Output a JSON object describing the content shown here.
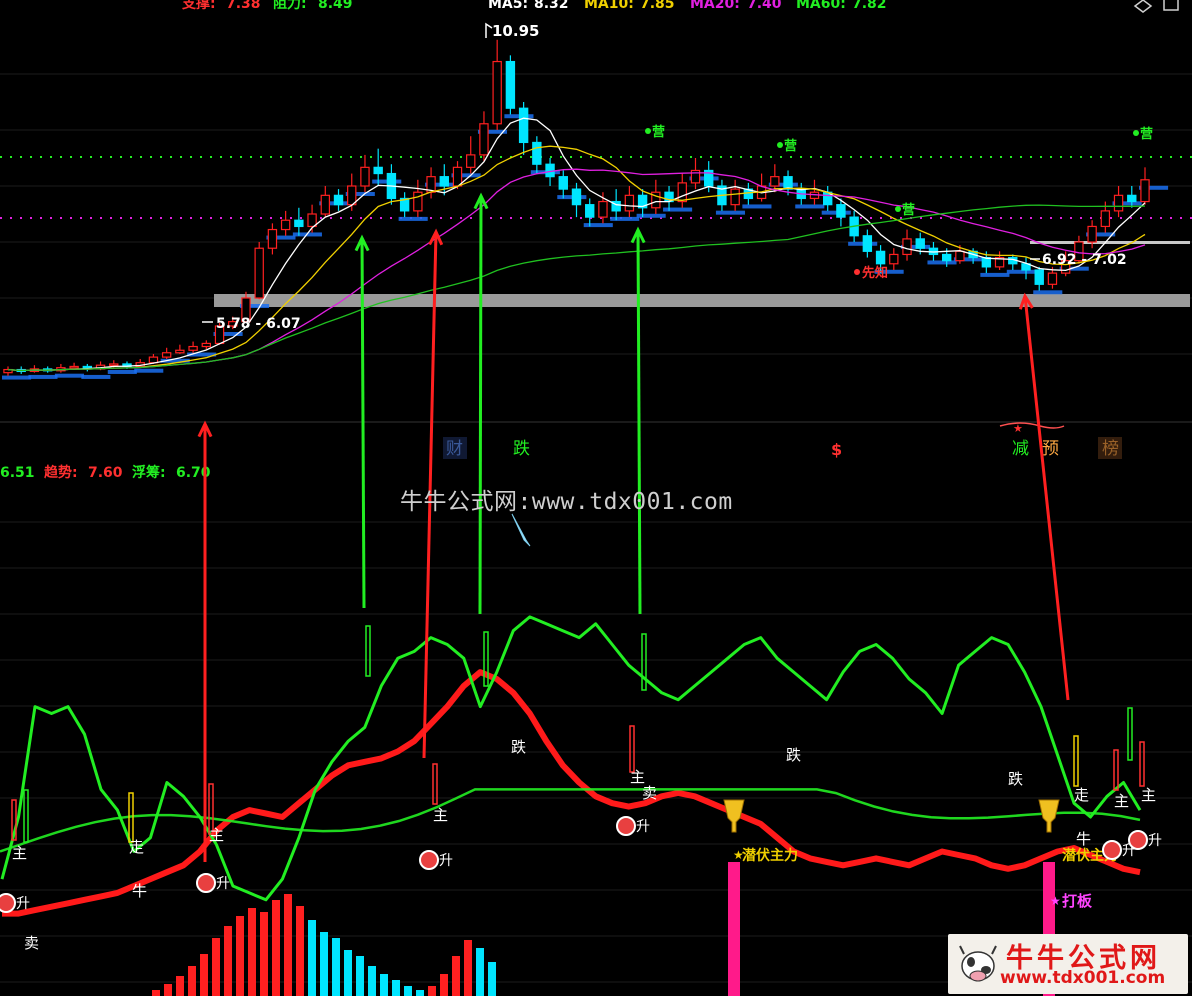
{
  "header": {
    "support_label": "支撑:",
    "support_value": "7.38",
    "resist_label": "阻力:",
    "resist_value": "8.49",
    "ma5_label": "MA5:",
    "ma5_value": "8.32",
    "ma10_label": "MA10:",
    "ma10_value": "7.85",
    "ma20_label": "MA20:",
    "ma20_value": "7.40",
    "ma60_label": "MA60:",
    "ma60_value": "7.82"
  },
  "indicator_header": {
    "first_value": "6.51",
    "trend_label": "趋势:",
    "trend_value": "7.60",
    "float_label": "浮筹:",
    "float_value": "6.70"
  },
  "price_labels": {
    "high": "10.95",
    "low_range": "5.78 - 6.07",
    "right_range": "6.92 - 7.02"
  },
  "event_labels": [
    {
      "text": "财",
      "color": "#6aa0ff"
    },
    {
      "text": "跌",
      "color": "#22ee22"
    },
    {
      "text": "$",
      "color": "#ff3030"
    },
    {
      "text": "减",
      "color": "#22ee22"
    },
    {
      "text": "预",
      "color": "#ffaa44"
    },
    {
      "text": "榜",
      "color": "#ffaa44"
    }
  ],
  "chart_markers": {
    "ying": "营",
    "zhu": "主",
    "zou": "走",
    "niu": "牛",
    "sheng": "升",
    "mai_sell": "卖",
    "die": "跌",
    "xian_zhi": "先知",
    "qian_fu": "潜伏主力",
    "da_ban": "打板"
  },
  "watermark": "牛牛公式网:www.tdx001.com",
  "logo": {
    "name": "牛牛公式网",
    "url": "www.tdx001.com"
  },
  "colors": {
    "up": "#ff2020",
    "down": "#00e5ff",
    "ma5": "#ffffff",
    "ma10": "#f0d000",
    "ma20": "#e020e0",
    "ma60": "#20c020",
    "trend": "#ff1a1a",
    "float": "#22ee22",
    "arrow_green": "#22ee22",
    "arrow_red": "#ff2020"
  },
  "chart_data": [
    {
      "type": "candlestick",
      "title": "",
      "ylim": [
        5.0,
        11.3
      ],
      "series": [
        {
          "name": "MA5"
        },
        {
          "name": "MA10"
        },
        {
          "name": "MA20"
        },
        {
          "name": "MA60"
        }
      ],
      "candles": [
        [
          5.6,
          5.65,
          5.55,
          5.7
        ],
        [
          5.65,
          5.62,
          5.58,
          5.7
        ],
        [
          5.62,
          5.66,
          5.6,
          5.72
        ],
        [
          5.66,
          5.63,
          5.6,
          5.7
        ],
        [
          5.63,
          5.68,
          5.6,
          5.74
        ],
        [
          5.68,
          5.7,
          5.65,
          5.76
        ],
        [
          5.7,
          5.66,
          5.62,
          5.74
        ],
        [
          5.66,
          5.72,
          5.64,
          5.78
        ],
        [
          5.72,
          5.74,
          5.68,
          5.8
        ],
        [
          5.74,
          5.7,
          5.66,
          5.78
        ],
        [
          5.7,
          5.76,
          5.68,
          5.82
        ],
        [
          5.76,
          5.85,
          5.74,
          5.9
        ],
        [
          5.85,
          5.92,
          5.82,
          6.0
        ],
        [
          5.92,
          5.96,
          5.9,
          6.05
        ],
        [
          5.96,
          6.02,
          5.92,
          6.1
        ],
        [
          6.02,
          6.07,
          5.98,
          6.12
        ],
        [
          6.07,
          6.35,
          6.05,
          6.4
        ],
        [
          6.35,
          6.42,
          6.3,
          6.5
        ],
        [
          6.42,
          6.8,
          6.4,
          6.9
        ],
        [
          6.8,
          7.6,
          6.78,
          7.7
        ],
        [
          7.6,
          7.9,
          7.5,
          8.0
        ],
        [
          7.9,
          8.05,
          7.8,
          8.2
        ],
        [
          8.05,
          7.95,
          7.8,
          8.25
        ],
        [
          7.95,
          8.15,
          7.85,
          8.3
        ],
        [
          8.15,
          8.45,
          8.1,
          8.6
        ],
        [
          8.45,
          8.3,
          8.2,
          8.55
        ],
        [
          8.3,
          8.6,
          8.2,
          8.8
        ],
        [
          8.6,
          8.9,
          8.5,
          9.1
        ],
        [
          8.9,
          8.8,
          8.6,
          9.2
        ],
        [
          8.8,
          8.4,
          8.3,
          8.95
        ],
        [
          8.4,
          8.2,
          8.1,
          8.5
        ],
        [
          8.2,
          8.5,
          8.1,
          8.7
        ],
        [
          8.5,
          8.75,
          8.4,
          8.9
        ],
        [
          8.75,
          8.6,
          8.45,
          8.95
        ],
        [
          8.6,
          8.9,
          8.55,
          9.0
        ],
        [
          8.9,
          9.1,
          8.8,
          9.4
        ],
        [
          9.1,
          9.6,
          9.0,
          9.8
        ],
        [
          9.6,
          10.6,
          9.5,
          10.95
        ],
        [
          10.6,
          9.85,
          9.75,
          10.7
        ],
        [
          9.85,
          9.3,
          9.1,
          9.95
        ],
        [
          9.3,
          8.95,
          8.8,
          9.4
        ],
        [
          8.95,
          8.75,
          8.6,
          9.05
        ],
        [
          8.75,
          8.55,
          8.4,
          8.85
        ],
        [
          8.55,
          8.3,
          8.1,
          8.65
        ],
        [
          8.3,
          8.1,
          7.95,
          8.4
        ],
        [
          8.1,
          8.35,
          8.0,
          8.5
        ],
        [
          8.35,
          8.2,
          8.05,
          8.55
        ],
        [
          8.2,
          8.45,
          8.1,
          8.6
        ],
        [
          8.45,
          8.25,
          8.1,
          8.55
        ],
        [
          8.25,
          8.5,
          8.15,
          8.7
        ],
        [
          8.5,
          8.35,
          8.2,
          8.6
        ],
        [
          8.35,
          8.65,
          8.25,
          8.8
        ],
        [
          8.65,
          8.85,
          8.55,
          9.05
        ],
        [
          8.85,
          8.6,
          8.5,
          9.0
        ],
        [
          8.6,
          8.3,
          8.2,
          8.7
        ],
        [
          8.3,
          8.55,
          8.2,
          8.7
        ],
        [
          8.55,
          8.4,
          8.3,
          8.65
        ],
        [
          8.4,
          8.6,
          8.35,
          8.8
        ],
        [
          8.6,
          8.75,
          8.5,
          8.95
        ],
        [
          8.75,
          8.55,
          8.45,
          8.85
        ],
        [
          8.55,
          8.4,
          8.3,
          8.65
        ],
        [
          8.4,
          8.5,
          8.3,
          8.7
        ],
        [
          8.5,
          8.3,
          8.2,
          8.6
        ],
        [
          8.3,
          8.1,
          7.95,
          8.4
        ],
        [
          8.1,
          7.8,
          7.7,
          8.2
        ],
        [
          7.8,
          7.55,
          7.45,
          7.9
        ],
        [
          7.55,
          7.35,
          7.2,
          7.65
        ],
        [
          7.35,
          7.5,
          7.25,
          7.6
        ],
        [
          7.5,
          7.75,
          7.4,
          7.9
        ],
        [
          7.75,
          7.6,
          7.5,
          7.85
        ],
        [
          7.6,
          7.5,
          7.4,
          7.7
        ],
        [
          7.5,
          7.4,
          7.3,
          7.6
        ],
        [
          7.4,
          7.55,
          7.35,
          7.65
        ],
        [
          7.55,
          7.45,
          7.35,
          7.6
        ],
        [
          7.45,
          7.3,
          7.2,
          7.55
        ],
        [
          7.3,
          7.45,
          7.25,
          7.55
        ],
        [
          7.45,
          7.35,
          7.25,
          7.5
        ],
        [
          7.35,
          7.25,
          7.1,
          7.45
        ],
        [
          7.25,
          7.02,
          6.92,
          7.3
        ],
        [
          7.02,
          7.2,
          6.95,
          7.3
        ],
        [
          7.2,
          7.4,
          7.15,
          7.55
        ],
        [
          7.4,
          7.7,
          7.35,
          7.8
        ],
        [
          7.7,
          7.95,
          7.6,
          8.05
        ],
        [
          7.95,
          8.2,
          7.85,
          8.35
        ],
        [
          8.2,
          8.45,
          8.1,
          8.6
        ],
        [
          8.45,
          8.35,
          8.25,
          8.6
        ],
        [
          8.35,
          8.7,
          8.3,
          8.9
        ]
      ]
    },
    {
      "type": "line",
      "title": "",
      "ylim": [
        0,
        100
      ],
      "series": [
        {
          "name": "趋势",
          "values": [
            12,
            12,
            13,
            14,
            15,
            16,
            17,
            18,
            20,
            22,
            24,
            26,
            30,
            36,
            40,
            42,
            41,
            40,
            44,
            48,
            52,
            55,
            56,
            57,
            59,
            62,
            67,
            72,
            78,
            82,
            80,
            76,
            70,
            62,
            55,
            50,
            46,
            44,
            43,
            44,
            46,
            47,
            46,
            44,
            42,
            40,
            38,
            34,
            30,
            28,
            27,
            26,
            27,
            28,
            27,
            26,
            28,
            30,
            29,
            28,
            26,
            25,
            26,
            28,
            30,
            31,
            29,
            27,
            25,
            24
          ]
        },
        {
          "name": "浮筹",
          "values": [
            22,
            40,
            72,
            70,
            72,
            64,
            48,
            42,
            30,
            34,
            50,
            46,
            40,
            32,
            20,
            18,
            16,
            22,
            34,
            48,
            56,
            62,
            66,
            78,
            86,
            88,
            92,
            90,
            86,
            72,
            82,
            94,
            98,
            96,
            94,
            92,
            96,
            90,
            84,
            80,
            76,
            74,
            78,
            82,
            86,
            90,
            92,
            86,
            82,
            78,
            74,
            82,
            88,
            90,
            86,
            80,
            76,
            70,
            84,
            88,
            92,
            90,
            82,
            72,
            58,
            44,
            40,
            46,
            50,
            42
          ]
        }
      ]
    }
  ]
}
